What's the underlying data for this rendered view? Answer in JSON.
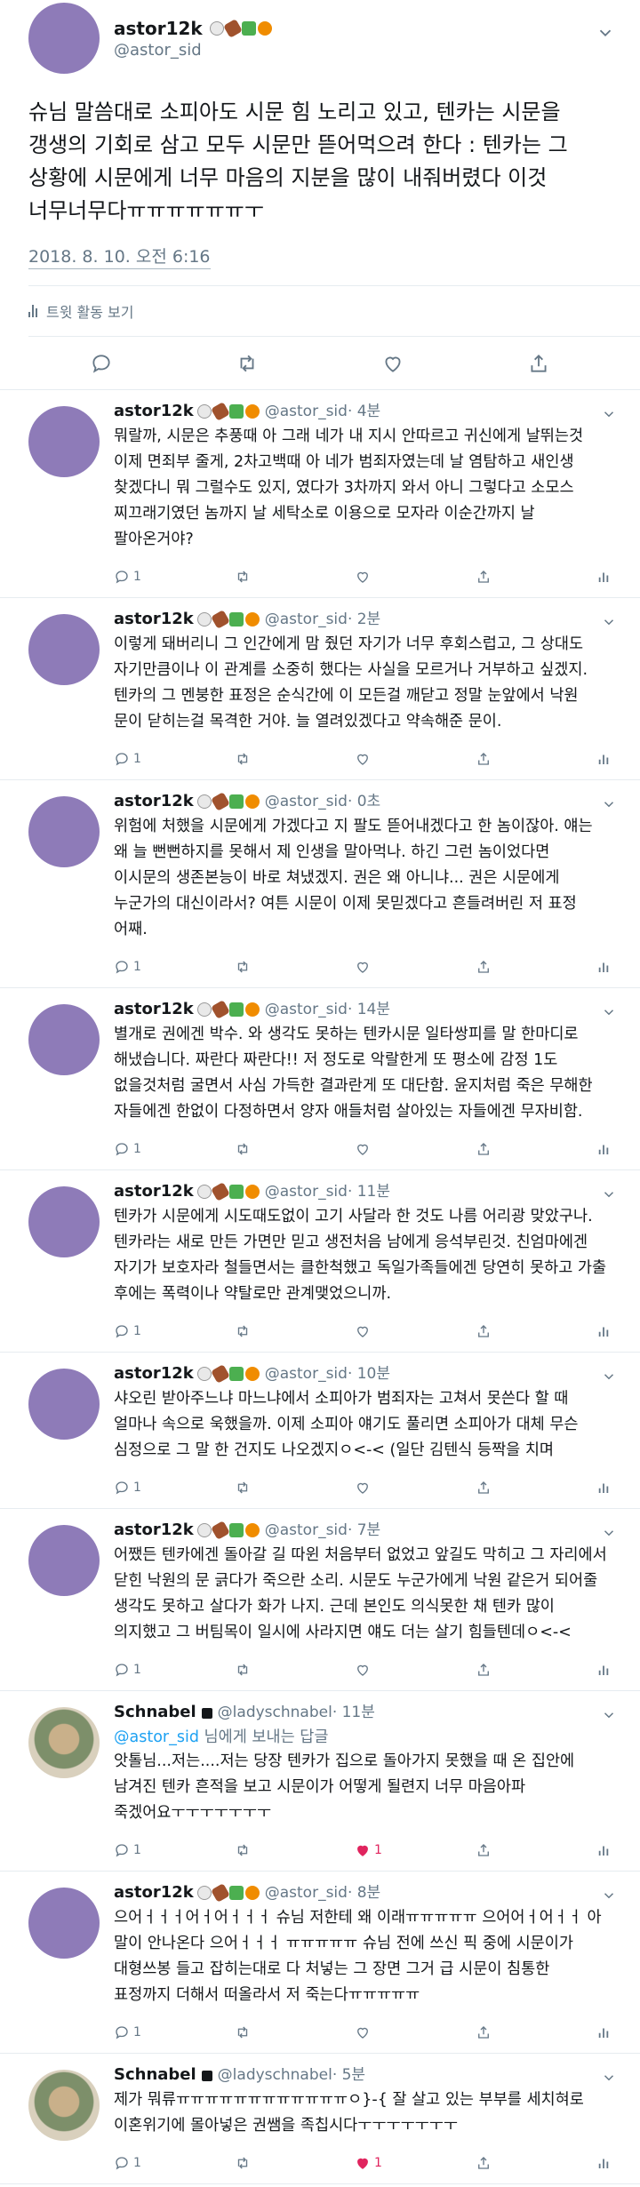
{
  "main_tweet": {
    "author_name": "astor12k",
    "author_handle": "@astor_sid",
    "text": "슈님 말씀대로 소피아도 시문 힘 노리고 있고, 텐카는 시문을 갱생의 기회로 삼고 모두 시문만 뜯어먹으려 한다 : 텐카는 그 상황에 시문에게 너무 마음의 지분을 많이 내줘버렸다 이것 너무너무다ㅠㅠㅠㅠㅠㅠㅜ",
    "timestamp": "2018. 8. 10. 오전 6:16",
    "activity_label": "트윗 활동 보기"
  },
  "replies": [
    {
      "name": "astor12k",
      "handle": "@astor_sid",
      "time": "· 4분",
      "text": "뭐랄까, 시문은 추풍때 아 그래 네가 내 지시 안따르고 귀신에게 날뛰는것 이제 면죄부 줄게, 2차고백때 아 네가 범죄자였는데 날 염탐하고 새인생 찾겠다니 뭐 그럴수도 있지, 였다가 3차까지 와서 아니 그렇다고 소모스 찌끄래기였던 놈까지 날 세탁소로 이용으로 모자라 이순간까지 날 팔아온거야?",
      "reply_count": "1",
      "like_count": "",
      "liked": false,
      "avatar": "purple"
    },
    {
      "name": "astor12k",
      "handle": "@astor_sid",
      "time": "· 2분",
      "text": "이렇게 돼버리니 그 인간에게 맘 줬던 자기가 너무 후회스럽고, 그 상대도 자기만큼이나 이 관계를 소중히 했다는 사실을 모르거나 거부하고 싶겠지. 텐카의 그 멘붕한 표정은 순식간에 이 모든걸 깨닫고 정말 눈앞에서 낙원 문이 닫히는걸 목격한 거야. 늘 열려있겠다고 약속해준 문이.",
      "reply_count": "1",
      "like_count": "",
      "liked": false,
      "avatar": "purple"
    },
    {
      "name": "astor12k",
      "handle": "@astor_sid",
      "time": "· 0초",
      "text": "위험에 처했을 시문에게 가겠다고 지 팔도 뜯어내겠다고 한 놈이잖아. 얘는 왜 늘 뻔뻔하지를 못해서 제 인생을 말아먹나. 하긴 그런 놈이었다면 이시문의 생존본능이 바로 쳐냈겠지. 권은 왜 아니냐... 권은 시문에게 누군가의 대신이라서? 여튼 시문이 이제 못믿겠다고 흔들려버린 저 표정 어째.",
      "reply_count": "1",
      "like_count": "",
      "liked": false,
      "avatar": "purple"
    },
    {
      "name": "astor12k",
      "handle": "@astor_sid",
      "time": "· 14분",
      "text": "별개로 권에겐 박수. 와 생각도 못하는 텐카시문 일타쌍피를 말 한마디로 해냈습니다. 짜란다 짜란다!! 저 정도로 악랄한게 또 평소에 감정 1도 없을것처럼 굴면서 사심 가득한 결과란게 또 대단함. 윤지처럼 죽은 무해한 자들에겐 한없이 다정하면서 양자 애들처럼 살아있는 자들에겐 무자비함.",
      "reply_count": "1",
      "like_count": "",
      "liked": false,
      "avatar": "purple"
    },
    {
      "name": "astor12k",
      "handle": "@astor_sid",
      "time": "· 11분",
      "text": "텐카가 시문에게 시도때도없이 고기 사달라 한 것도 나름 어리광 맞았구나. 텐카라는 새로 만든 가면만 믿고 생전처음 남에게 응석부린것. 친엄마에겐 자기가 보호자라 철들면서는 클한척했고 독일가족들에겐 당연히 못하고 가출 후에는 폭력이나 약탈로만 관계맺었으니까.",
      "reply_count": "1",
      "like_count": "",
      "liked": false,
      "avatar": "purple"
    },
    {
      "name": "astor12k",
      "handle": "@astor_sid",
      "time": "· 10분",
      "text": "샤오린 받아주느냐 마느냐에서 소피아가 범죄자는 고쳐서 못쓴다 할 때 얼마나 속으로 욱했을까. 이제 소피아 얘기도 풀리면 소피아가 대체 무슨 심정으로 그 말 한 건지도 나오겠지ㅇ<-< (일단 김텐식 등짝을 치며",
      "reply_count": "1",
      "like_count": "",
      "liked": false,
      "avatar": "purple"
    },
    {
      "name": "astor12k",
      "handle": "@astor_sid",
      "time": "· 7분",
      "text": "어쨌든 텐카에겐 돌아갈 길 따윈 처음부터 없었고 앞길도 막히고 그 자리에서 닫힌 낙원의 문 긁다가 죽으란 소리. 시문도 누군가에게 낙원 같은거 되어줄 생각도 못하고 살다가 화가 나지. 근데 본인도 의식못한 채 텐카 많이 의지했고 그 버팀목이 일시에 사라지면 얘도 더는 살기 힘들텐데ㅇ<-<",
      "reply_count": "1",
      "like_count": "",
      "liked": false,
      "avatar": "purple"
    },
    {
      "name": "Schnabel",
      "handle": "@ladyschnabel",
      "time": "· 11분",
      "locked": true,
      "reply_to_mention": "@astor_sid",
      "reply_to_suffix": " 님에게 보내는 답글",
      "text": "앗톨님...저는....저는 당장 텐카가 집으로 돌아가지 못했을 때 온 집안에 남겨진 텐카 흔적을 보고 시문이가 어떻게 될련지 너무 마음아파 죽겠어요ㅜㅜㅜㅜㅜㅜㅜ",
      "reply_count": "1",
      "like_count": "1",
      "liked": true,
      "avatar": "photo"
    },
    {
      "name": "astor12k",
      "handle": "@astor_sid",
      "time": "· 8분",
      "text": "으어ㅓㅓㅓ어ㅓ어ㅓㅓㅓ 슈님 저한테 왜 이래ㅠㅠㅠㅠㅠ 으어어ㅓ어ㅓㅓ 아 말이 안나온다 으어ㅓㅓㅓ ㅠㅠㅠㅠㅠ 슈님 전에 쓰신 픽 중에 시문이가 대형쓰봉 들고 잡히는대로 다 처넣는 그 장면 그거 급 시문이 침통한 표정까지 더해서 떠올라서 저 죽는다ㅠㅠㅠㅠㅠ",
      "reply_count": "1",
      "like_count": "",
      "liked": false,
      "avatar": "purple"
    },
    {
      "name": "Schnabel",
      "handle": "@ladyschnabel",
      "time": "· 5분",
      "locked": true,
      "text": "제가 뭐류ㅠㅠㅠㅠㅠㅠㅠㅠㅠㅠㅠㅠㅇ}-{ 잘 살고 있는 부부를 세치혀로 이혼위기에 몰아넣은 권쌤을 족칩시다ㅜㅜㅜㅜㅜㅜㅜ",
      "reply_count": "1",
      "like_count": "1",
      "liked": true,
      "avatar": "photo"
    }
  ]
}
